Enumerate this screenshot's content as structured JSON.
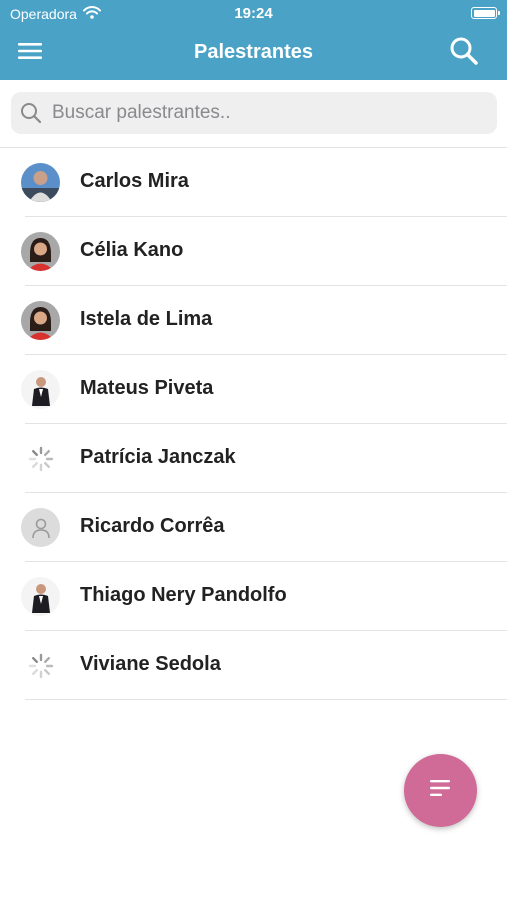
{
  "status_bar": {
    "carrier": "Operadora",
    "time": "19:24",
    "wifi_icon": "wifi-icon",
    "battery_icon": "battery-icon"
  },
  "header": {
    "title": "Palestrantes",
    "menu_icon": "hamburger-menu-icon",
    "search_icon": "search-icon",
    "color": "#4aa3c6"
  },
  "search": {
    "placeholder": "Buscar palestrantes..",
    "value": ""
  },
  "speakers": [
    {
      "name": "Carlos Mira",
      "avatar": "photo"
    },
    {
      "name": "Célia Kano",
      "avatar": "photo"
    },
    {
      "name": "Istela de Lima",
      "avatar": "photo"
    },
    {
      "name": "Mateus Piveta",
      "avatar": "photo"
    },
    {
      "name": "Patrícia Janczak",
      "avatar": "loading-spinner"
    },
    {
      "name": "Ricardo Corrêa",
      "avatar": "placeholder"
    },
    {
      "name": "Thiago Nery Pandolfo",
      "avatar": "photo"
    },
    {
      "name": "Viviane Sedola",
      "avatar": "loading-spinner"
    }
  ],
  "fab": {
    "icon": "filter-list-icon",
    "color": "#cf6b96"
  }
}
